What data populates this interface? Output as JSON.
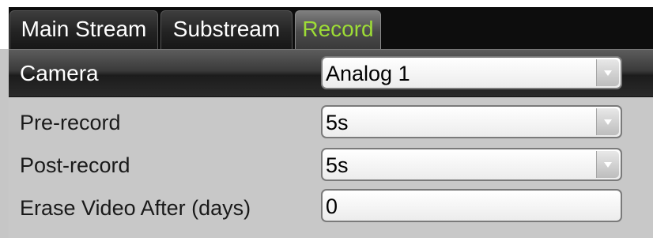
{
  "tabs": [
    {
      "label": "Main Stream",
      "active": false
    },
    {
      "label": "Substream",
      "active": false
    },
    {
      "label": "Record",
      "active": true
    }
  ],
  "camera": {
    "label": "Camera",
    "value": "Analog 1"
  },
  "fields": {
    "pre_record": {
      "label": "Pre-record",
      "value": "5s"
    },
    "post_record": {
      "label": "Post-record",
      "value": "5s"
    },
    "erase_after": {
      "label": "Erase Video After (days)",
      "value": "0"
    }
  },
  "colors": {
    "active_tab_text": "#9ddc36",
    "tab_background": "#232323",
    "panel_background": "#c8c8c8"
  },
  "icons": {
    "dropdown": "chevron-down-icon"
  }
}
